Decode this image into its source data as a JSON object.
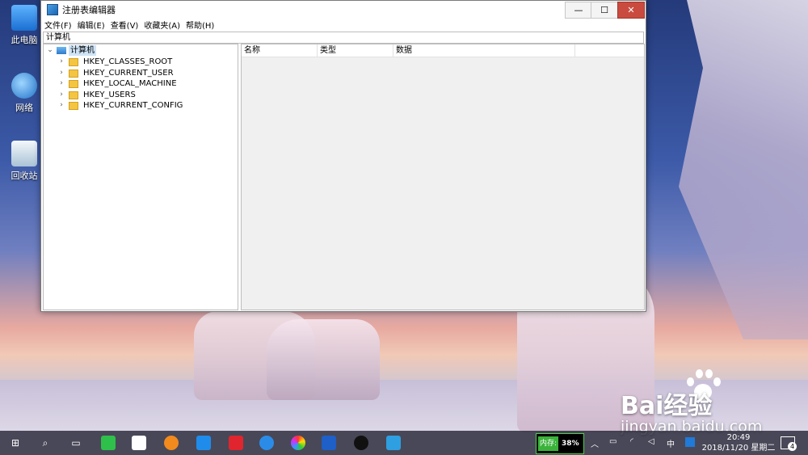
{
  "desktop": {
    "icons": [
      {
        "label": "此电脑"
      },
      {
        "label": "网络"
      },
      {
        "label": "回收站"
      }
    ]
  },
  "window": {
    "title": "注册表编辑器",
    "controls": {
      "min": "—",
      "max": "☐",
      "close": "✕"
    },
    "menu": [
      "文件(F)",
      "编辑(E)",
      "查看(V)",
      "收藏夹(A)",
      "帮助(H)"
    ],
    "address": "计算机",
    "tree": {
      "root": "计算机",
      "keys": [
        "HKEY_CLASSES_ROOT",
        "HKEY_CURRENT_USER",
        "HKEY_LOCAL_MACHINE",
        "HKEY_USERS",
        "HKEY_CURRENT_CONFIG"
      ]
    },
    "columns": [
      "名称",
      "类型",
      "数据"
    ]
  },
  "taskbar": {
    "memory_label": "内存:",
    "memory_value": "38%",
    "ime": "中",
    "time": "20:49",
    "date": "2018/11/20 星期二",
    "notification_count": "4"
  },
  "watermark": {
    "brand": "Bai经验",
    "url": "jingyan.baidu.com"
  }
}
